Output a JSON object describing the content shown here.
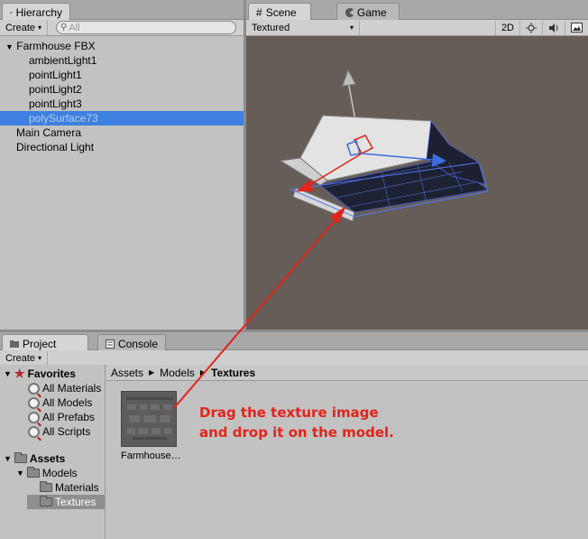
{
  "hierarchy": {
    "tab_label": "Hierarchy",
    "create_label": "Create",
    "search_placeholder": "All",
    "items": [
      {
        "label": "Farmhouse FBX"
      },
      {
        "label": "ambientLight1"
      },
      {
        "label": "pointLight1"
      },
      {
        "label": "pointLight2"
      },
      {
        "label": "pointLight3"
      },
      {
        "label": "polySurface73"
      },
      {
        "label": "Main Camera"
      },
      {
        "label": "Directional Light"
      }
    ]
  },
  "scene": {
    "tabs": [
      {
        "label": "Scene"
      },
      {
        "label": "Game"
      }
    ],
    "render_mode": "Textured",
    "toggle_2d": "2D",
    "icons": [
      "sun-icon",
      "audio-icon",
      "image-effects-icon"
    ]
  },
  "project": {
    "tabs": [
      {
        "label": "Project"
      },
      {
        "label": "Console"
      }
    ],
    "create_label": "Create",
    "favorites_label": "Favorites",
    "favorites": [
      {
        "label": "All Materials"
      },
      {
        "label": "All Models"
      },
      {
        "label": "All Prefabs"
      },
      {
        "label": "All Scripts"
      }
    ],
    "assets_label": "Assets",
    "folders": [
      {
        "label": "Models"
      },
      {
        "label": "Materials"
      },
      {
        "label": "Textures"
      }
    ],
    "breadcrumb": [
      "Assets",
      "Models",
      "Textures"
    ],
    "asset_item": "Farmhouse…"
  },
  "annotation": {
    "line1": "Drag the texture image",
    "line2": "and drop it on the model.",
    "color": "#e2241b"
  }
}
